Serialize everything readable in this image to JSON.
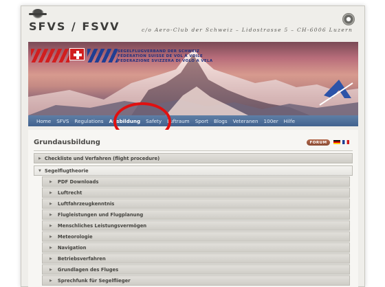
{
  "header": {
    "site_title": "SFVS / FSVV",
    "address": "c/o Aero-Club der Schweiz – Lidostrasse 5 – CH-6006 Luzern"
  },
  "banner": {
    "org_lines": [
      "SEGELFLUGVERBAND DER SCHWEIZ",
      "FÉDÉRATION SUISSE DE VOL À VOILE",
      "FEDERAZIONE SVIZZERA DI VOLO A VELA"
    ]
  },
  "nav": {
    "items": [
      {
        "label": "Home",
        "active": false
      },
      {
        "label": "SFVS",
        "active": false
      },
      {
        "label": "Regulations",
        "active": false
      },
      {
        "label": "Ausbildung",
        "active": true
      },
      {
        "label": "Safety",
        "active": false
      },
      {
        "label": "Luftraum",
        "active": false
      },
      {
        "label": "Sport",
        "active": false
      },
      {
        "label": "Blogs",
        "active": false
      },
      {
        "label": "Veteranen",
        "active": false
      },
      {
        "label": "100er",
        "active": false
      },
      {
        "label": "Hilfe",
        "active": false
      }
    ]
  },
  "colors": {
    "highlight": "#e01010",
    "nav_bg": "#41628e",
    "forum_bg": "#8a4a32"
  },
  "content": {
    "title": "Grundausbildung",
    "forum_label": "FORUM",
    "sections": [
      {
        "label": "Checkliste und Verfahren (flight procedure)",
        "expanded": false
      },
      {
        "label": "Segelflugtheorie",
        "expanded": true
      }
    ],
    "subsections": [
      "PDF Downloads",
      "Luftrecht",
      "Luftfahrzeugkenntnis",
      "Flugleistungen und Flugplanung",
      "Menschliches Leistungsvermögen",
      "Meteorologie",
      "Navigation",
      "Betriebsverfahren",
      "Grundlagen des Fluges",
      "Sprechfunk für Segelflieger"
    ]
  }
}
